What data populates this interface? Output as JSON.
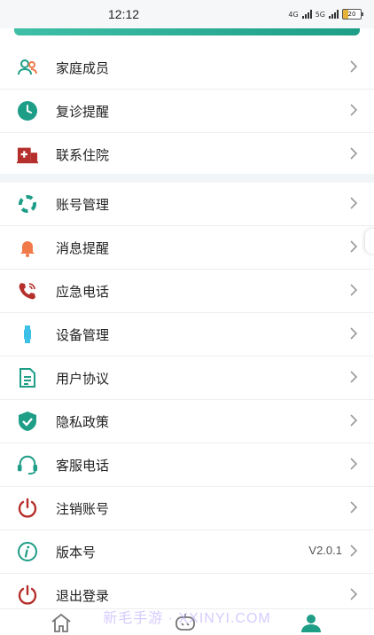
{
  "status_bar": {
    "time": "12:12",
    "signal1": "4G",
    "signal2": "5G",
    "battery": "20"
  },
  "group1": [
    {
      "id": "family",
      "label": "家庭成员",
      "icon": "family-members-icon"
    },
    {
      "id": "followup",
      "label": "复诊提醒",
      "icon": "clock-icon"
    },
    {
      "id": "hospital",
      "label": "联系住院",
      "icon": "hospital-icon"
    }
  ],
  "group2": [
    {
      "id": "account",
      "label": "账号管理",
      "icon": "account-ring-icon"
    },
    {
      "id": "message",
      "label": "消息提醒",
      "icon": "bell-icon"
    },
    {
      "id": "emergency",
      "label": "应急电话",
      "icon": "phone-call-icon"
    },
    {
      "id": "device",
      "label": "设备管理",
      "icon": "watch-icon"
    },
    {
      "id": "agreement",
      "label": "用户协议",
      "icon": "document-icon"
    },
    {
      "id": "privacy",
      "label": "隐私政策",
      "icon": "shield-check-icon"
    },
    {
      "id": "service",
      "label": "客服电话",
      "icon": "headset-icon"
    },
    {
      "id": "deregister",
      "label": "注销账号",
      "icon": "power-icon"
    },
    {
      "id": "version",
      "label": "版本号",
      "icon": "info-icon",
      "value": "V2.0.1"
    },
    {
      "id": "logout",
      "label": "退出登录",
      "icon": "power-icon"
    }
  ],
  "watermark": "新毛手游 · XXINYI.COM",
  "bottom_nav": [
    {
      "id": "home",
      "icon": "home-icon",
      "active": false
    },
    {
      "id": "robot",
      "icon": "robot-icon",
      "active": false
    },
    {
      "id": "profile",
      "icon": "person-icon",
      "active": true
    }
  ],
  "colors": {
    "accent": "#1e9d87",
    "danger": "#b5302c",
    "orange": "#f07a4a",
    "text": "#222222"
  }
}
